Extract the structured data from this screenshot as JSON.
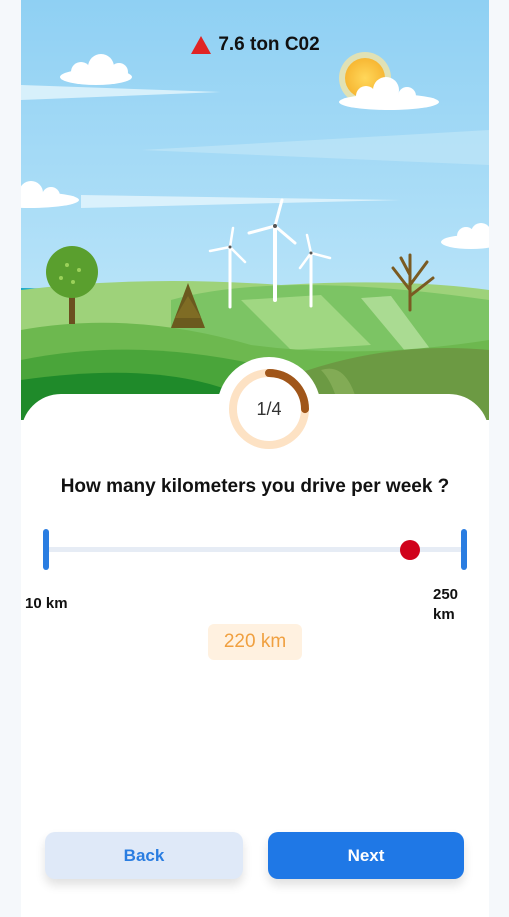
{
  "header": {
    "co2_text": "7.6 ton C02",
    "warning_icon": "warning-triangle-icon"
  },
  "progress": {
    "label": "1/4",
    "fraction": 0.25
  },
  "question": {
    "text": "How many kilometers you drive per week ?"
  },
  "slider": {
    "min_label": "10 km",
    "max_line1": "250",
    "max_line2": "km",
    "min": 10,
    "max": 250,
    "value": 220,
    "value_text": "220 km"
  },
  "buttons": {
    "back_label": "Back",
    "next_label": "Next"
  },
  "colors": {
    "accent": "#1f78e6",
    "thumb": "#d0021b",
    "progress_arc": "#a0561a",
    "progress_track": "#fde2c4",
    "value_text": "#f0a040"
  }
}
